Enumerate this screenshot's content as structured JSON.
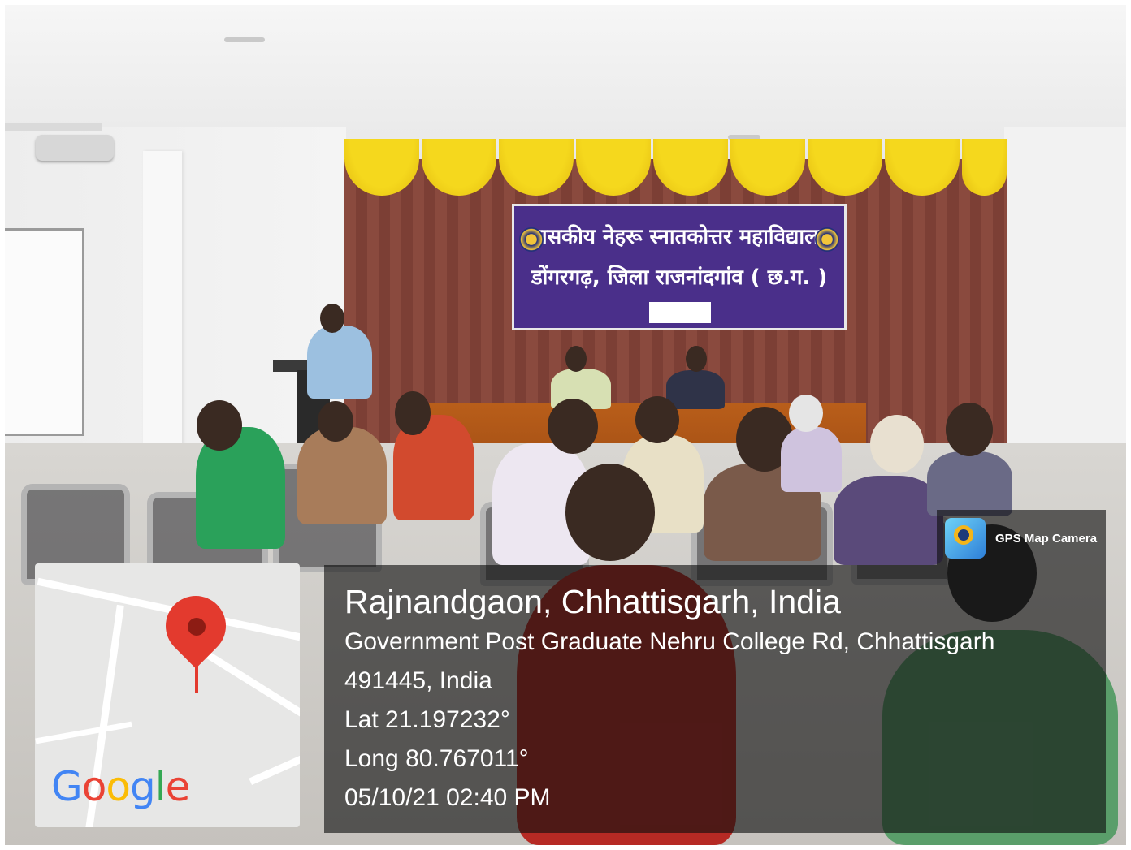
{
  "banner": {
    "line1": "शासकीय नेहरू स्नातकोत्तर महाविद्यालय",
    "line2": "डोंगरगढ़, जिला राजनांदगांव ( छ.ग. )"
  },
  "map": {
    "logo_text": "Google",
    "pin_color": "#e33a2e"
  },
  "badge": {
    "label": "GPS Map Camera",
    "icon": "gps-map-camera-icon"
  },
  "location": {
    "title": "Rajnandgaon, Chhattisgarh, India",
    "address_line1": "Government Post Graduate Nehru College Rd, Chhattisgarh",
    "address_line2": "491445, India",
    "lat": "Lat 21.197232°",
    "long": "Long 80.767011°",
    "datetime": "05/10/21 02:40 PM"
  }
}
